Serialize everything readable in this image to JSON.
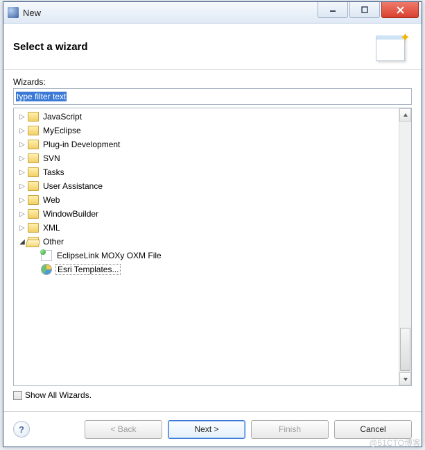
{
  "window": {
    "title": "New"
  },
  "banner": {
    "heading": "Select a wizard"
  },
  "body": {
    "wizards_label": "Wizards:",
    "filter_placeholder": "type filter text",
    "show_all_label": "Show All Wizards."
  },
  "tree": {
    "items": [
      {
        "label": "JavaScript",
        "expanded": false
      },
      {
        "label": "MyEclipse",
        "expanded": false
      },
      {
        "label": "Plug-in Development",
        "expanded": false
      },
      {
        "label": "SVN",
        "expanded": false
      },
      {
        "label": "Tasks",
        "expanded": false
      },
      {
        "label": "User Assistance",
        "expanded": false
      },
      {
        "label": "Web",
        "expanded": false
      },
      {
        "label": "WindowBuilder",
        "expanded": false
      },
      {
        "label": "XML",
        "expanded": false
      },
      {
        "label": "Other",
        "expanded": true,
        "children": [
          {
            "label": "EclipseLink MOXy OXM File",
            "icon": "moxy"
          },
          {
            "label": "Esri Templates...",
            "icon": "esri",
            "focused": true
          }
        ]
      }
    ]
  },
  "buttons": {
    "help_tooltip": "Help",
    "back": "< Back",
    "next": "Next >",
    "finish": "Finish",
    "cancel": "Cancel"
  },
  "watermark": "@51CTO博客"
}
